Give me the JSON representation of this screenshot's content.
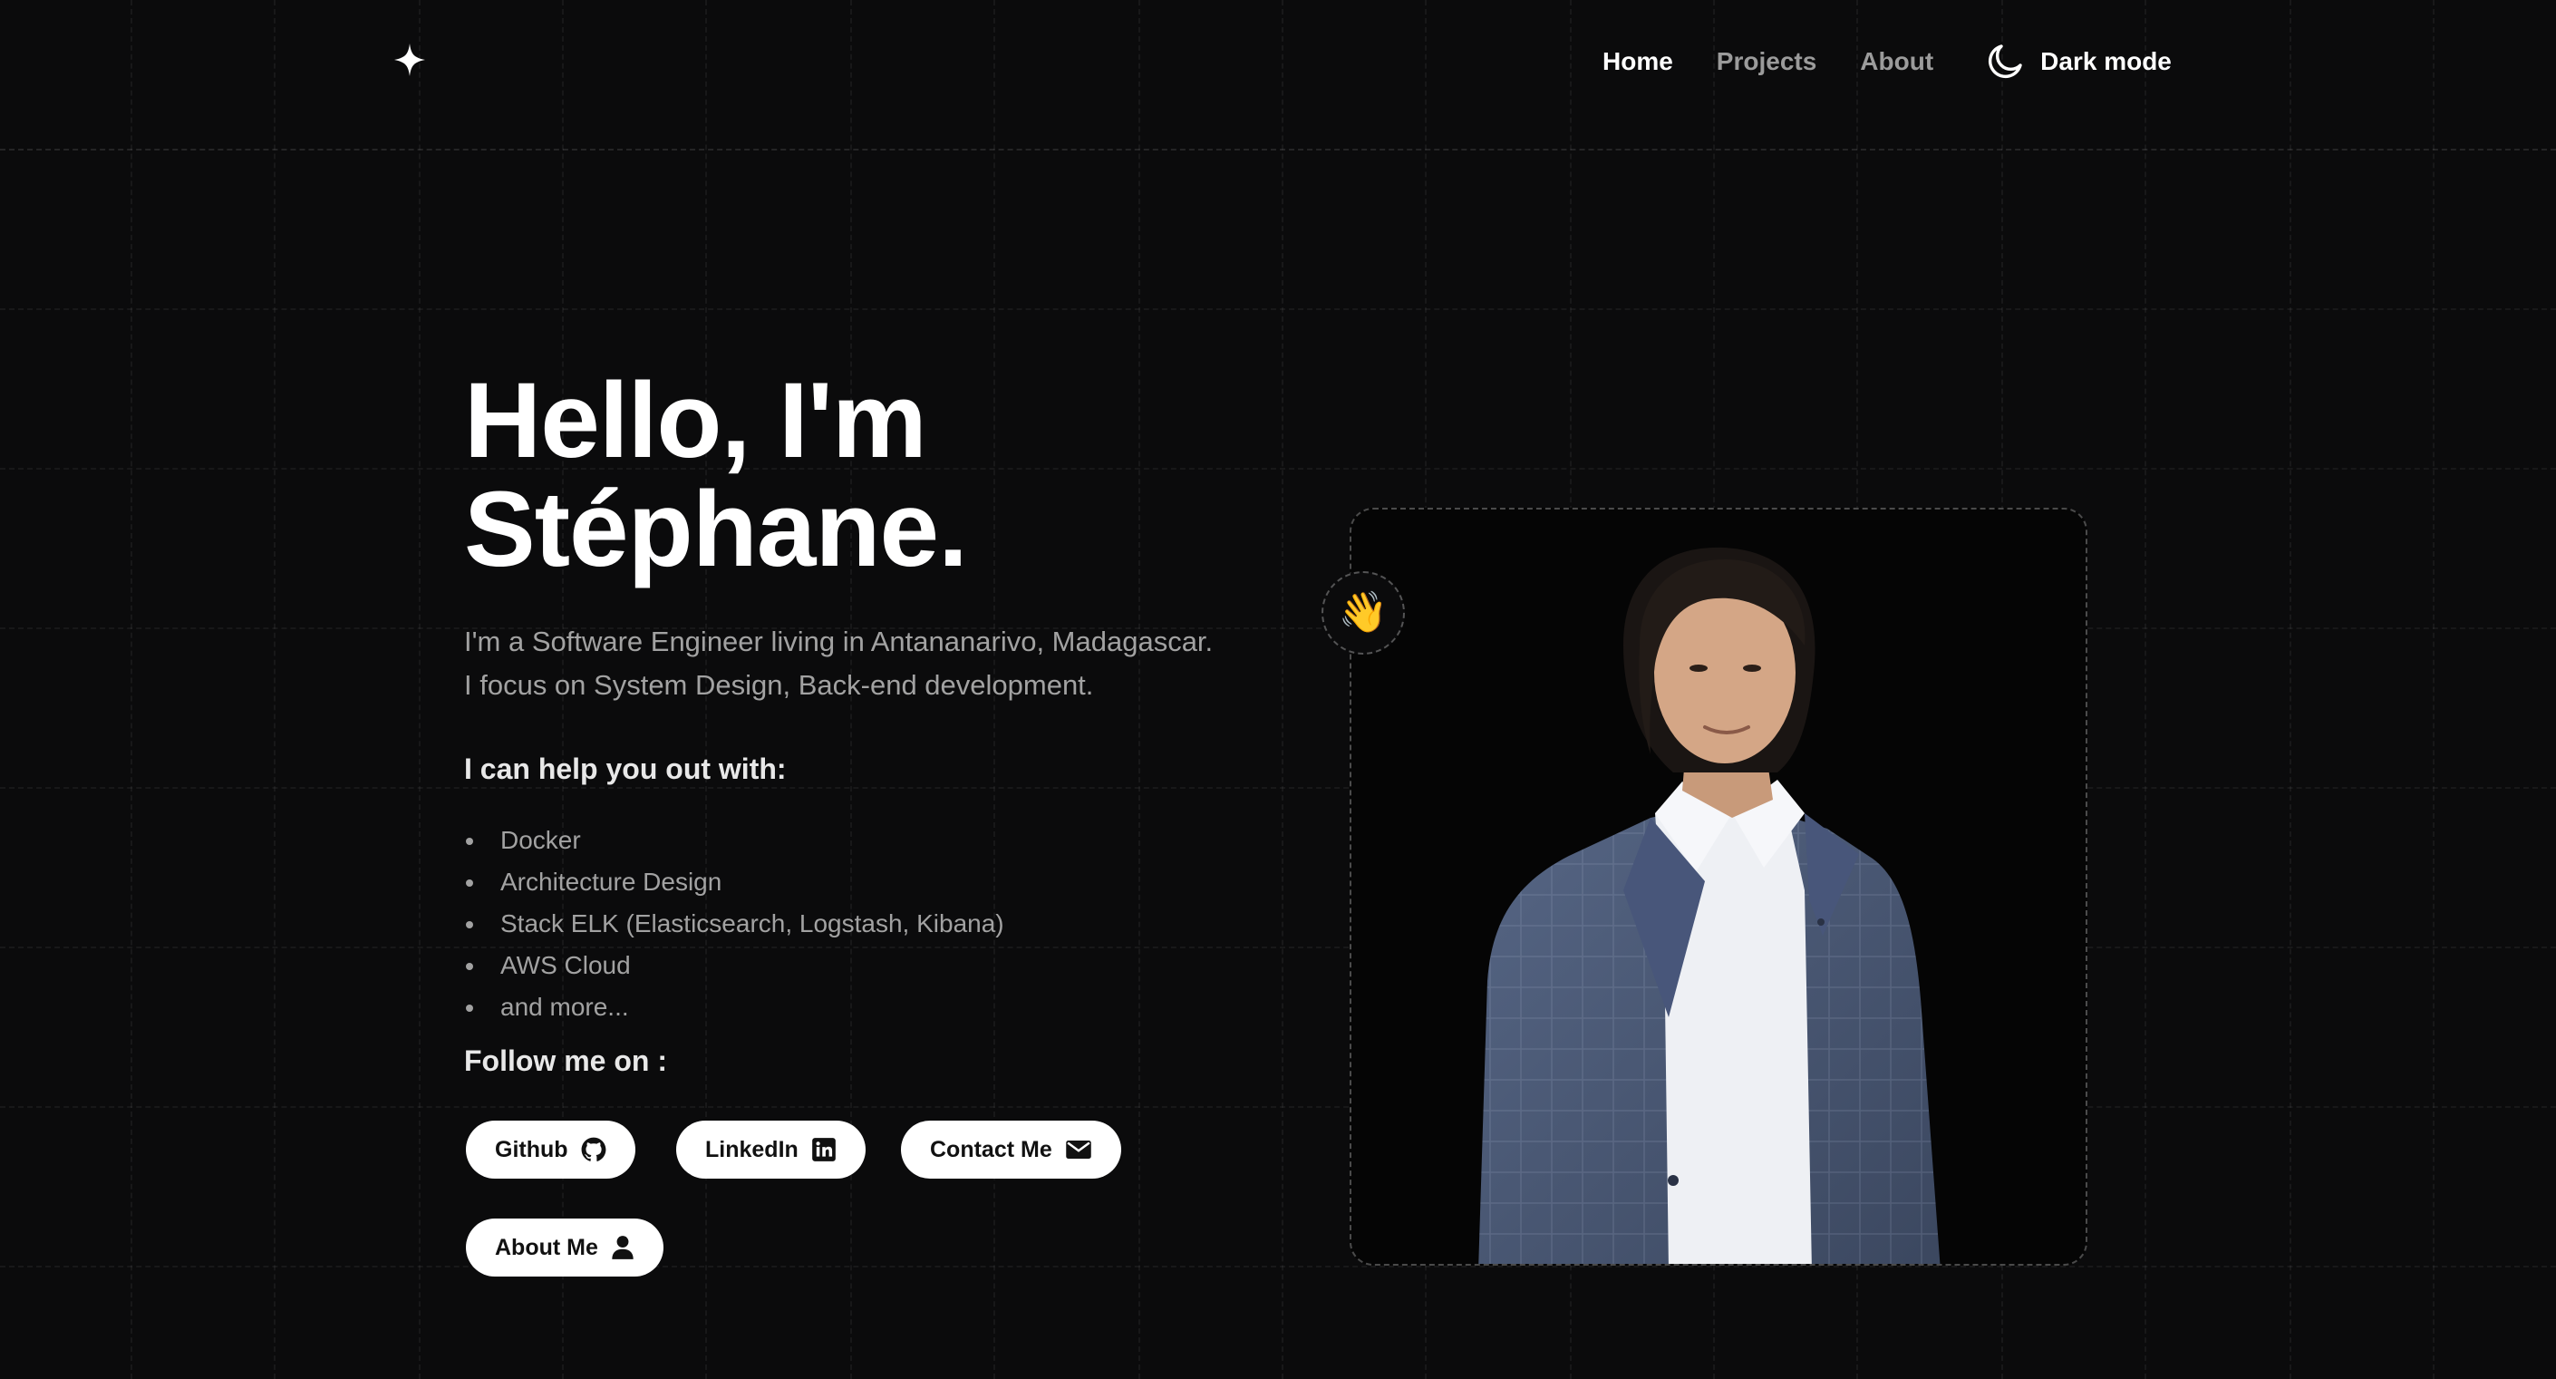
{
  "header": {
    "logo_icon": "sparkle-icon",
    "nav": [
      {
        "label": "Home",
        "active": true
      },
      {
        "label": "Projects",
        "active": false
      },
      {
        "label": "About",
        "active": false
      }
    ],
    "dark_mode_label": "Dark mode",
    "dark_mode_icon": "moon-icon"
  },
  "hero": {
    "title_line1": "Hello, I'm",
    "title_line2": "Stéphane.",
    "intro_line1": "I'm a Software Engineer living in Antananarivo, Madagascar.",
    "intro_line2": "I focus on System Design, Back-end development.",
    "help_title": "I can help you out with:",
    "skills": [
      "Docker",
      "Architecture Design",
      "Stack ELK (Elasticsearch, Logstash, Kibana)",
      "AWS Cloud",
      "and more..."
    ],
    "follow_title": "Follow me on :",
    "buttons": {
      "github": "Github",
      "linkedin": "LinkedIn",
      "contact": "Contact Me",
      "about": "About Me"
    }
  },
  "photo": {
    "wave_emoji": "👋"
  },
  "colors": {
    "background": "#0b0b0c",
    "text_primary": "#ffffff",
    "text_muted": "#a2a2a2",
    "button_bg": "#ffffff",
    "button_text": "#111111"
  }
}
